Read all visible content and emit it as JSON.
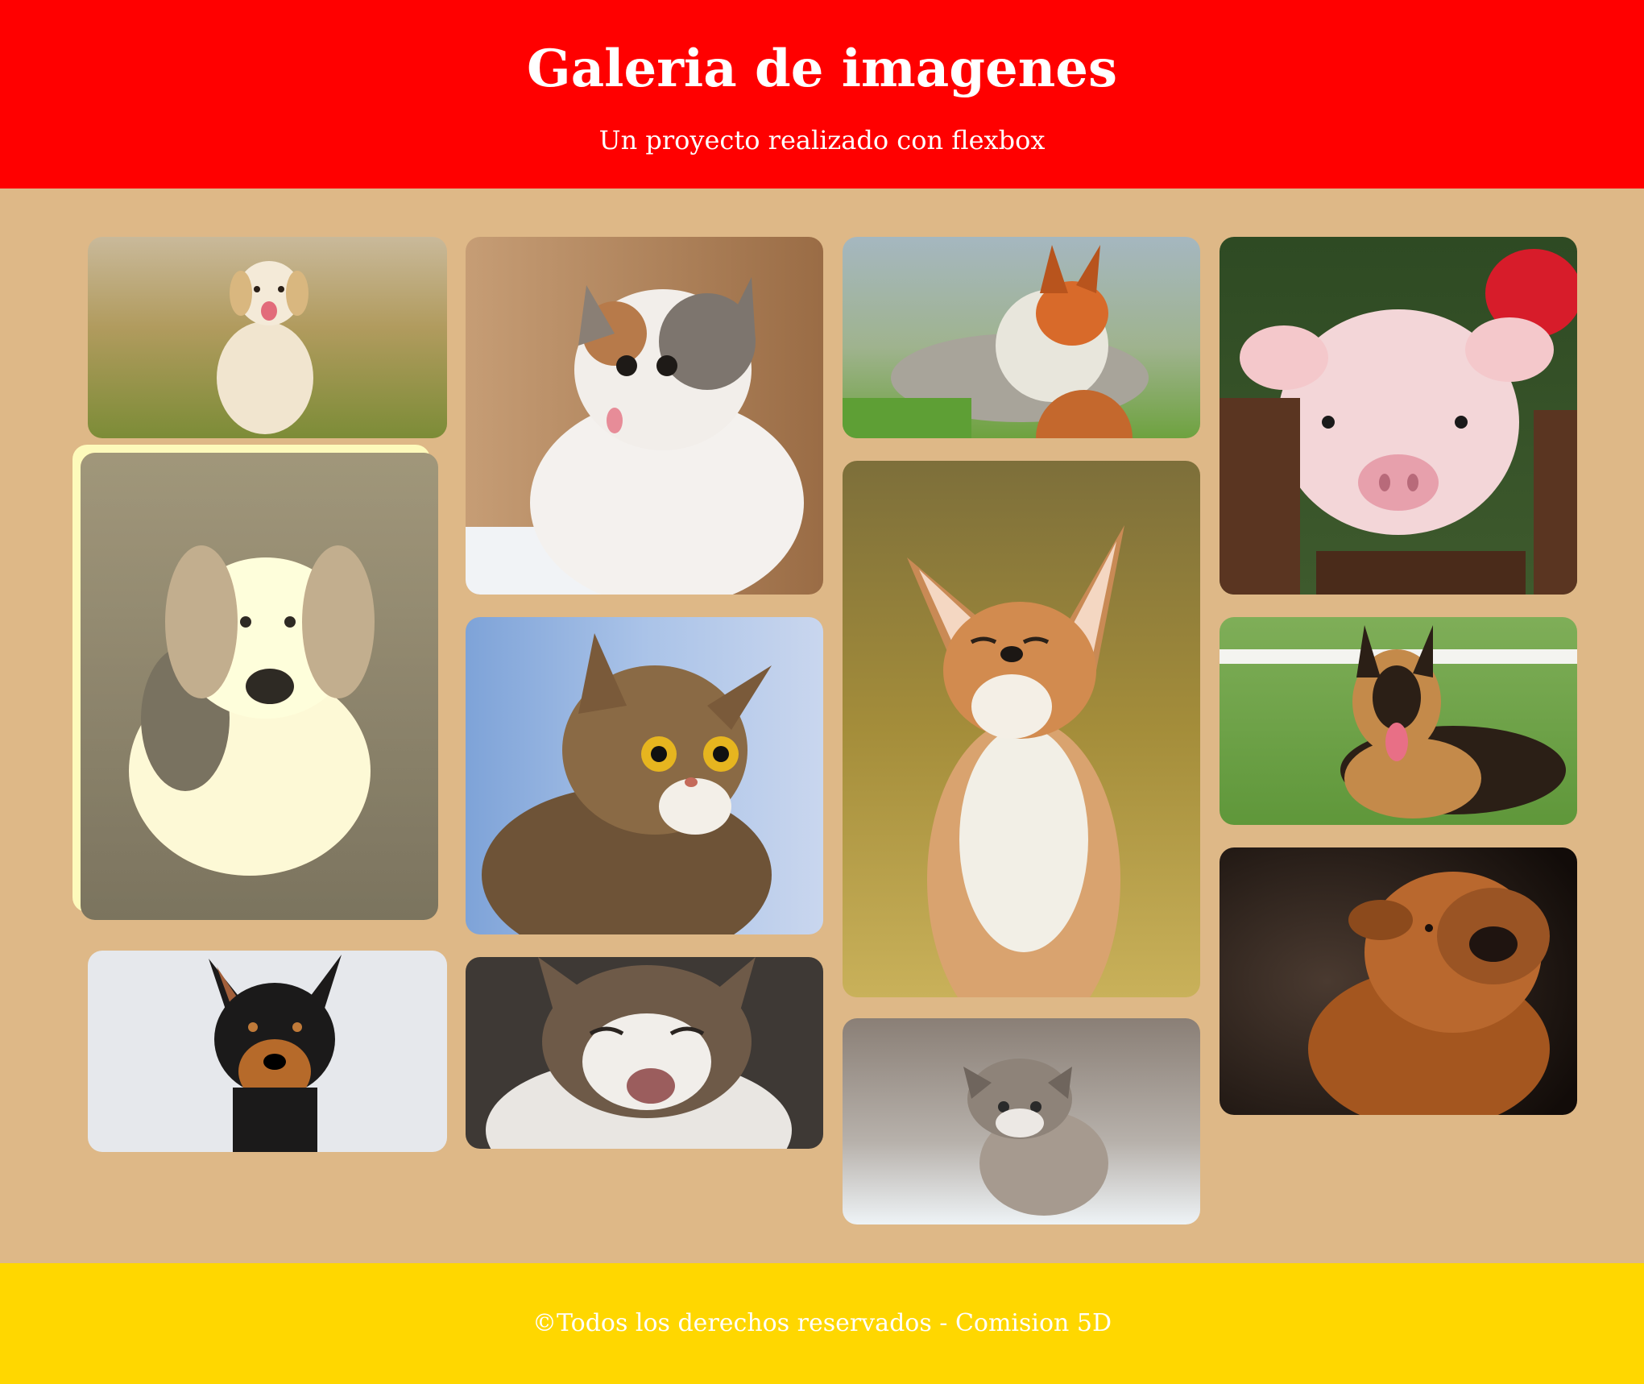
{
  "header": {
    "title": "Galeria de imagenes",
    "subtitle": "Un proyecto realizado con flexbox"
  },
  "colors": {
    "header_bg": "#FF0000",
    "page_bg": "#DEB887",
    "footer_bg": "#FFD700",
    "highlight_border": "#FFE680"
  },
  "gallery": [
    {
      "id": "golden-retriever-puppy-photo",
      "subject": "golden retriever puppy running on grass",
      "palette": [
        "#b7a36a",
        "#7f8b3a",
        "#f2e9d8"
      ]
    },
    {
      "id": "beagle-puppy-photo",
      "subject": "beagle puppy on grass (sepia hover effect)",
      "palette": [
        "#9c9a73",
        "#6f6d52",
        "#e8e2c8"
      ]
    },
    {
      "id": "doberman-puppy-photo",
      "subject": "miniature pinscher with big ears",
      "palette": [
        "#e6e8ec",
        "#1a1a1a",
        "#b66a2a"
      ]
    },
    {
      "id": "calico-kitten-photo",
      "subject": "calico kitten looking up",
      "palette": [
        "#b98a5c",
        "#f4f1ee",
        "#7d756e"
      ]
    },
    {
      "id": "tabby-cat-surprised-photo",
      "subject": "tabby cat with wide eyes",
      "palette": [
        "#8fb0e0",
        "#8a6a45",
        "#3b2d20"
      ]
    },
    {
      "id": "laughing-cat-photo",
      "subject": "cat laughing with mouth open",
      "palette": [
        "#3f3a36",
        "#e9e6e2",
        "#6e5a48"
      ]
    },
    {
      "id": "red-fox-grass-photo",
      "subject": "red fox in grass",
      "palette": [
        "#8fb36d",
        "#d86a2a",
        "#e8e6dc"
      ]
    },
    {
      "id": "smiling-fox-photo",
      "subject": "fennec-like fox smiling with eyes closed",
      "palette": [
        "#a48d3a",
        "#d28b4f",
        "#f2efe6"
      ]
    },
    {
      "id": "gray-kitten-photo",
      "subject": "small gray tabby kitten",
      "palette": [
        "#a69a8f",
        "#e7eef2",
        "#55514d"
      ]
    },
    {
      "id": "piglet-photo",
      "subject": "pink piglet behind wooden posts",
      "palette": [
        "#2e4a23",
        "#f3d6d8",
        "#5a3521"
      ]
    },
    {
      "id": "german-shepherd-photo",
      "subject": "german shepherd lying on grass",
      "palette": [
        "#6ea64a",
        "#2b1f16",
        "#c48a4a"
      ]
    },
    {
      "id": "shar-pei-photo",
      "subject": "shar pei puppy on dark background",
      "palette": [
        "#1d1410",
        "#b9682e",
        "#5a3c2c"
      ]
    }
  ],
  "footer": {
    "text": "©Todos los derechos reservados - Comision 5D"
  }
}
